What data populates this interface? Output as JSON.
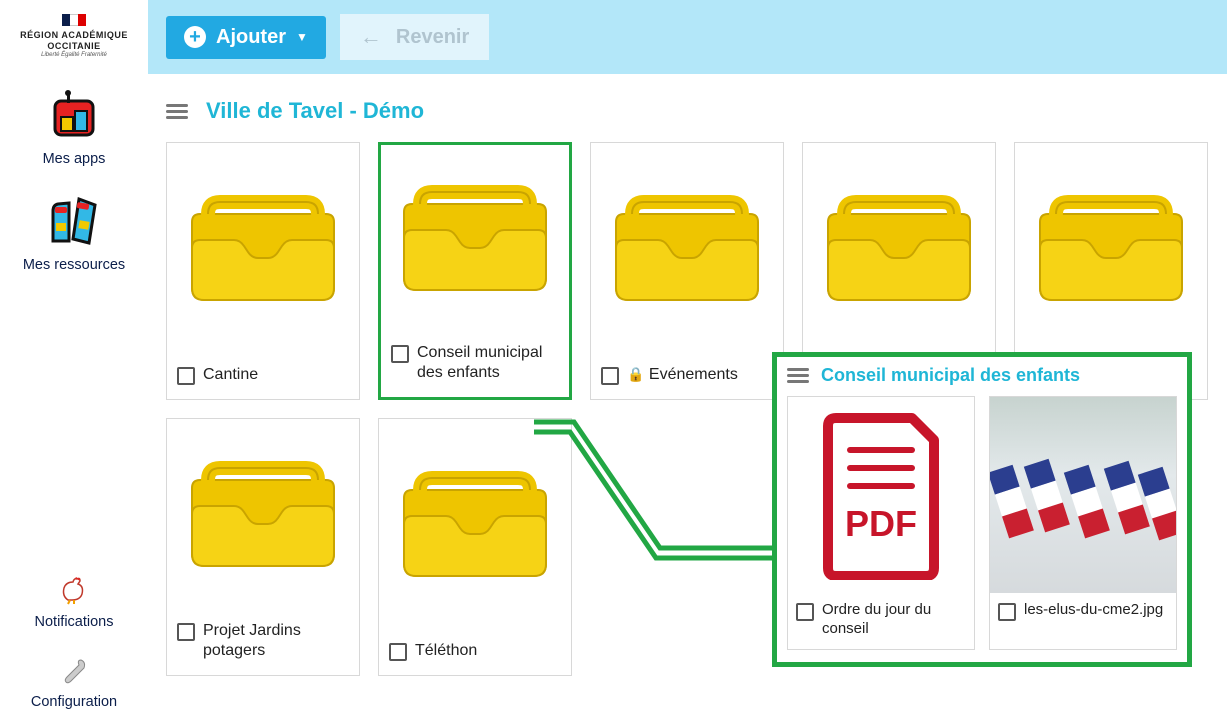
{
  "sidebar": {
    "logo_line1": "RÉGION ACADÉMIQUE",
    "logo_line2": "OCCITANIE",
    "logo_motto": "Liberté Égalité Fraternité",
    "items": [
      {
        "label": "Mes apps",
        "icon": "apps"
      },
      {
        "label": "Mes ressources",
        "icon": "resources"
      }
    ],
    "bottom": [
      {
        "label": "Notifications",
        "icon": "bell"
      },
      {
        "label": "Configuration",
        "icon": "wrench"
      }
    ]
  },
  "toolbar": {
    "add_label": "Ajouter",
    "back_label": "Revenir"
  },
  "breadcrumb": {
    "title": "Ville de Tavel - Démo"
  },
  "folders": [
    {
      "label": "Cantine",
      "locked": false,
      "selected": false
    },
    {
      "label": "Conseil municipal des enfants",
      "locked": false,
      "selected": true
    },
    {
      "label": "Evénements",
      "locked": true,
      "selected": false
    },
    {
      "label": "",
      "locked": false,
      "selected": false
    },
    {
      "label": "",
      "locked": false,
      "selected": false
    },
    {
      "label": "Projet Jardins potagers",
      "locked": false,
      "selected": false
    },
    {
      "label": "Téléthon",
      "locked": false,
      "selected": false
    }
  ],
  "popup": {
    "title": "Conseil municipal des enfants",
    "items": [
      {
        "label": "Ordre du jour du conseil",
        "type": "pdf"
      },
      {
        "label": "les-elus-du-cme2.jpg",
        "type": "image"
      }
    ]
  },
  "colors": {
    "accent": "#22a9e2",
    "title": "#1fb6d6",
    "selected": "#22a744",
    "folder": "#f2c900"
  }
}
